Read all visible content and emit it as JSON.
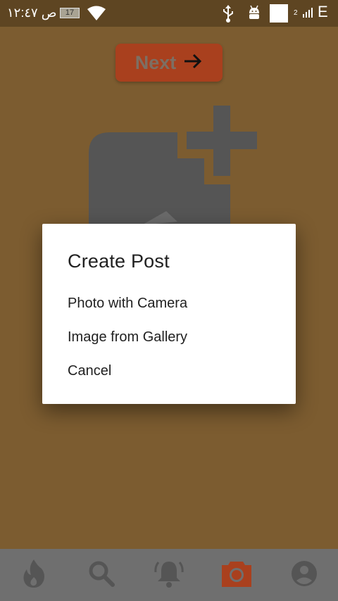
{
  "status_bar": {
    "time": "ص ١٢:٤٧",
    "battery": "17",
    "signal_label": "2",
    "network": "E"
  },
  "background": {
    "next_button_label": "Next",
    "accent_color": "#a9401e"
  },
  "dialog": {
    "title": "Create Post",
    "options": [
      "Photo with Camera",
      "Image from Gallery",
      "Cancel"
    ]
  },
  "bottom_nav": {
    "items": [
      "fire-icon",
      "search-icon",
      "notifications-icon",
      "camera-icon",
      "account-icon"
    ],
    "active": "camera-icon"
  }
}
